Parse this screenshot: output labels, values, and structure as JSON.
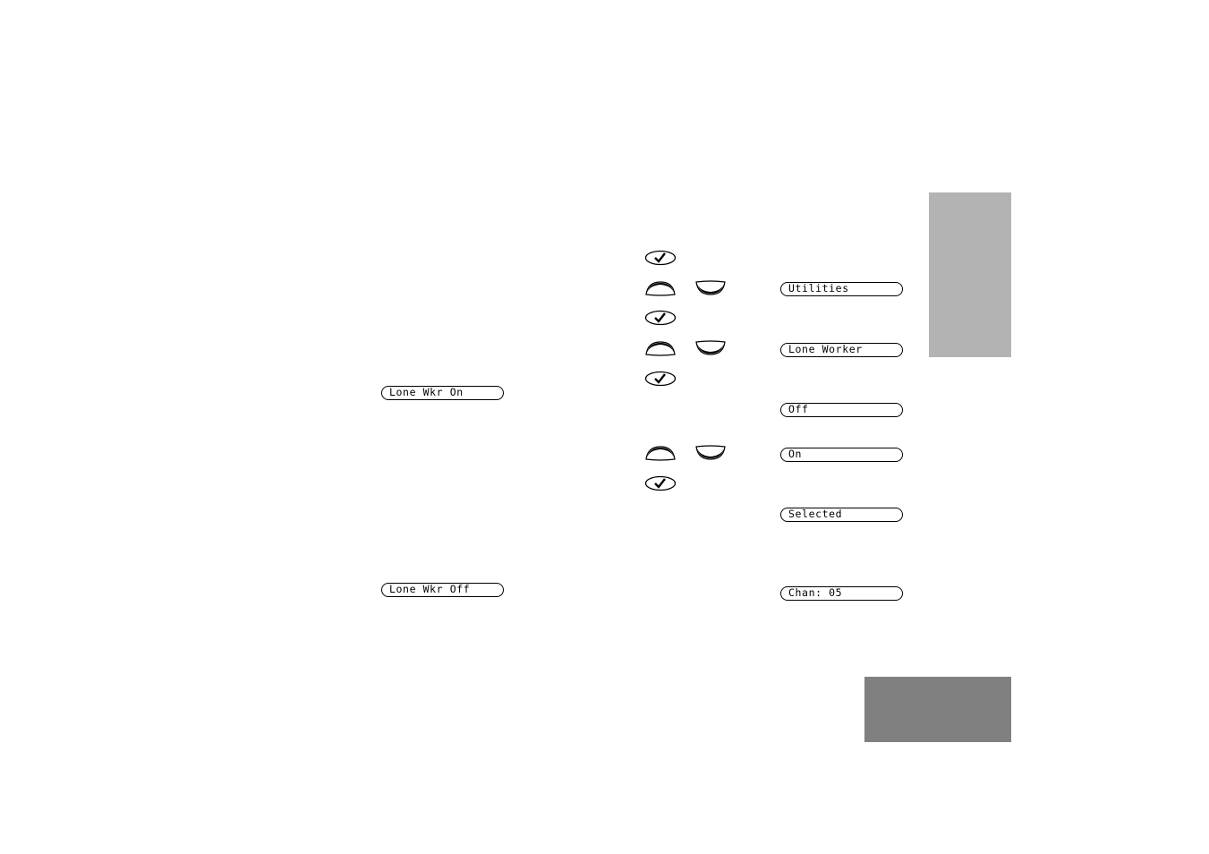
{
  "page": {
    "tabs": {
      "light_color": "#b3b3b3",
      "dark_color": "#808080"
    }
  },
  "left_displays": [
    {
      "text": "Lone Wkr On"
    },
    {
      "text": "Lone Wkr Off"
    }
  ],
  "procedure": {
    "steps": [
      {
        "keys": [
          "menu-select-key"
        ]
      },
      {
        "keys": [
          "scroll-up-key",
          "scroll-down-key"
        ],
        "display": "Utilities"
      },
      {
        "keys": [
          "menu-select-key"
        ]
      },
      {
        "keys": [
          "scroll-up-key",
          "scroll-down-key"
        ],
        "display": "Lone Worker"
      },
      {
        "keys": [
          "menu-select-key"
        ],
        "display": "Off"
      },
      {
        "keys": [
          "scroll-up-key",
          "scroll-down-key"
        ],
        "display": "On"
      },
      {
        "keys": [
          "menu-select-key"
        ],
        "display": "Selected"
      },
      {
        "display": "Chan: 05"
      }
    ]
  },
  "displays": {
    "utilities": "Utilities",
    "lone_worker": "Lone Worker",
    "off": "Off",
    "on": "On",
    "selected": "Selected",
    "chan": "Chan: 05"
  }
}
